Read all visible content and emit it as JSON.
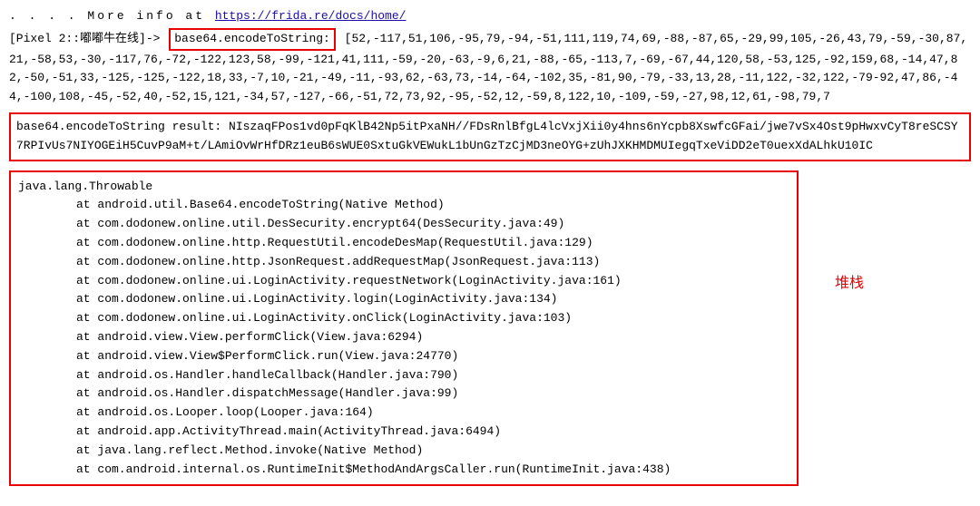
{
  "info_line": {
    "prefix": ". . . .    More info at ",
    "link_text": "https://frida.re/docs/home/"
  },
  "prompt": {
    "device_part": "[Pixel 2::嘟嘟牛在线]-> ",
    "call_label": "base64.encodeToString:",
    "raw_bytes": "  [52,-117,51,106,-95,79,-94,-51,111,119,74,69,-88,-87,65,-29,99,105,-26,43,79,-59,-30,87,21,-58,53,-30,-117,76,-72,-122,123,58,-99,-121,41,111,-59,-20,-63,-9,6,21,-88,-65,-113,7,-69,-67,44,120,58,-53,125,-92,159,68,-14,47,82,-50,-51,33,-125,-125,-122,18,33,-7,10,-21,-49,-11,-93,62,-63,73,-14,-64,-102,35,-81,90,-79,-33,13,28,-11,122,-32,122,-79-92,47,86,-44,-100,108,-45,-52,40,-52,15,121,-34,57,-127,-66,-51,72,73,92,-95,-52,12,-59,8,122,10,-109,-59,-27,98,12,61,-98,79,7"
  },
  "result": {
    "label": "base64.encodeToString result:   ",
    "value": "NIszaqFPos1vd0pFqKlB42Np5itPxaNH//FDsRnlBfgL4lcVxjXii0y4hns6nYcpb8XswfcGFai/jwe7vSx4Ost9pHwxvCyT8reSCSY7RPIvUs7NIYOGEiH5CuvP9aM+t/LAmiOvWrHfDRz1euB6sWUE0SxtuGkVEWukL1bUnGzTzCjMD3neOYG+zUhJXKHMDMUIegqTxeViDD2eT0uexXdALhkU10IC"
  },
  "stack": {
    "header": "java.lang.Throwable",
    "lines": [
      "at android.util.Base64.encodeToString(Native Method)",
      "at com.dodonew.online.util.DesSecurity.encrypt64(DesSecurity.java:49)",
      "at com.dodonew.online.http.RequestUtil.encodeDesMap(RequestUtil.java:129)",
      "at com.dodonew.online.http.JsonRequest.addRequestMap(JsonRequest.java:113)",
      "at com.dodonew.online.ui.LoginActivity.requestNetwork(LoginActivity.java:161)",
      "at com.dodonew.online.ui.LoginActivity.login(LoginActivity.java:134)",
      "at com.dodonew.online.ui.LoginActivity.onClick(LoginActivity.java:103)",
      "at android.view.View.performClick(View.java:6294)",
      "at android.view.View$PerformClick.run(View.java:24770)",
      "at android.os.Handler.handleCallback(Handler.java:790)",
      "at android.os.Handler.dispatchMessage(Handler.java:99)",
      "at android.os.Looper.loop(Looper.java:164)",
      "at android.app.ActivityThread.main(ActivityThread.java:6494)",
      "at java.lang.reflect.Method.invoke(Native Method)",
      "at com.android.internal.os.RuntimeInit$MethodAndArgsCaller.run(RuntimeInit.java:438)"
    ]
  },
  "annotation": "堆栈"
}
